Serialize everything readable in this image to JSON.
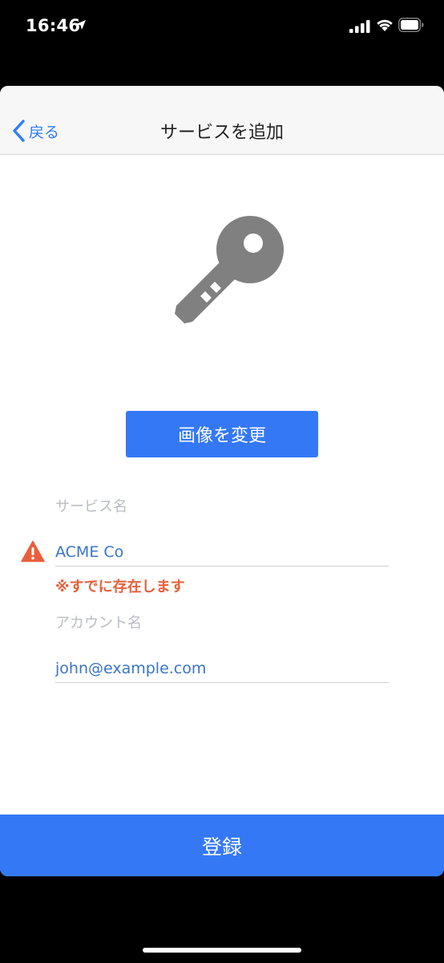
{
  "status_bar": {
    "time": "16:46",
    "icons": [
      "location-arrow-icon",
      "cellular-signal-icon",
      "wifi-icon",
      "battery-icon"
    ]
  },
  "nav": {
    "back_label": "戻る",
    "title": "サービスを追加"
  },
  "image": {
    "icon": "key-icon",
    "change_button_label": "画像を変更"
  },
  "form": {
    "service_label": "サービス名",
    "service_value": "ACME Co",
    "service_error": "※すでに存在します",
    "account_label": "アカウント名",
    "account_value": "john@example.com"
  },
  "footer": {
    "register_label": "登録"
  },
  "colors": {
    "accent": "#3478f6",
    "error": "#e8603b",
    "input_text": "#3a74c9",
    "placeholder": "#b9bcc2"
  }
}
